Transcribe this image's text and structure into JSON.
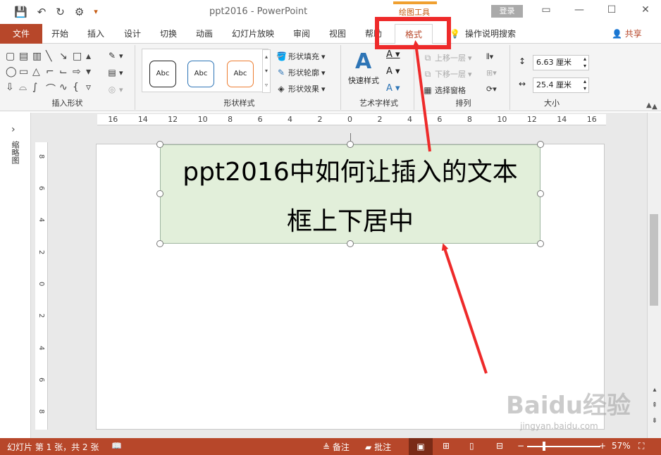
{
  "window": {
    "title": "ppt2016  -  PowerPoint",
    "contextual_tab_group": "绘图工具",
    "login_label": "登录",
    "controls": [
      "▭",
      "—",
      "☐",
      "✕"
    ]
  },
  "qat": {
    "save_icon": "💾",
    "undo_icon": "↶",
    "redo_icon": "↻",
    "present_icon": "⚙",
    "customize_icon": "▾"
  },
  "tabs": [
    {
      "label": "文件"
    },
    {
      "label": "开始"
    },
    {
      "label": "插入"
    },
    {
      "label": "设计"
    },
    {
      "label": "切换"
    },
    {
      "label": "动画"
    },
    {
      "label": "幻灯片放映"
    },
    {
      "label": "审阅"
    },
    {
      "label": "视图"
    },
    {
      "label": "帮助"
    },
    {
      "label": "格式"
    }
  ],
  "tell_me": "操作说明搜索",
  "share_label": "共享",
  "ribbon": {
    "insert_shapes_label": "插入形状",
    "shape_styles_label": "形状样式",
    "style_sample": "Abc",
    "fill_label": "形状填充",
    "outline_label": "形状轮廓",
    "effects_label": "形状效果",
    "wordart_label": "艺术字样式",
    "quick_styles": "快速样式",
    "arrange_label": "排列",
    "bring_forward": "上移一层",
    "send_backward": "下移一层",
    "selection_pane": "选择窗格",
    "size_label": "大小",
    "height_value": "6.63 厘米",
    "width_value": "25.4 厘米"
  },
  "left_panel": {
    "label": "缩略图",
    "collapse_icon": "›"
  },
  "ruler_h_labels": [
    "16",
    "14",
    "12",
    "10",
    "8",
    "6",
    "4",
    "2",
    "0",
    "2",
    "4",
    "6",
    "8",
    "10",
    "12",
    "14",
    "16"
  ],
  "ruler_v_labels": [
    "8",
    "6",
    "4",
    "2",
    "0",
    "2",
    "4",
    "6",
    "8"
  ],
  "slide": {
    "textbox_line1": "ppt2016中如何让插入的文本",
    "textbox_line2": "框上下居中",
    "textbox_fill": "#e2efda"
  },
  "status": {
    "slide_info": "幻灯片 第 1 张，共 2 张",
    "notes": "备注",
    "comments": "批注",
    "zoom": "57%",
    "bar_color": "#b7472a"
  },
  "watermark": {
    "main": "Baidu经验",
    "sub": "jingyan.baidu.com"
  },
  "colors": {
    "accent": "#b7472a",
    "highlight": "#ee2a2a"
  }
}
